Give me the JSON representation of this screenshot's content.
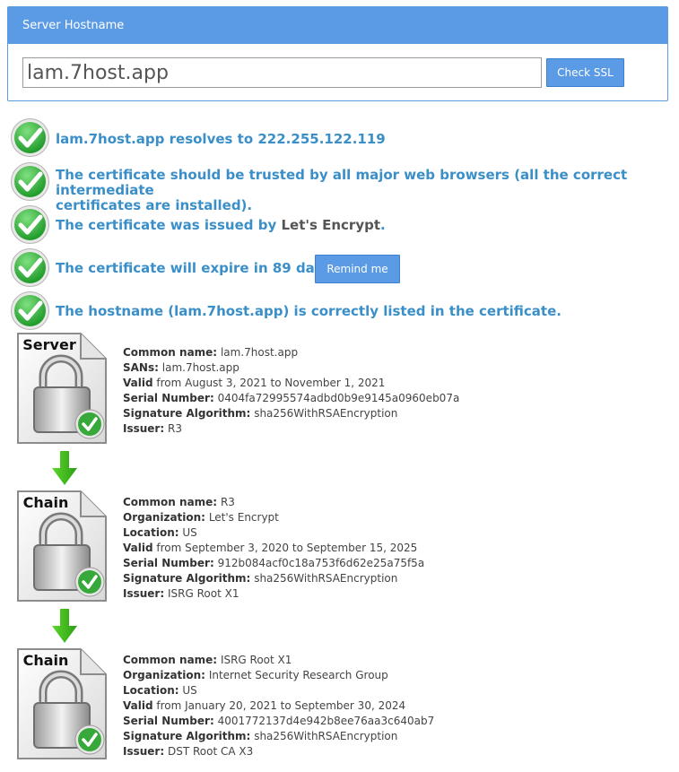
{
  "header": {
    "title": "Server Hostname"
  },
  "search": {
    "value": "lam.7host.app",
    "button": "Check SSL"
  },
  "results": {
    "r1": "lam.7host.app resolves to 222.255.122.119",
    "r2a": "The certificate should be trusted by all major web browsers (all the correct intermediate",
    "r2b": "certificates are installed).",
    "r3_prefix": "The certificate was issued by ",
    "r3_issuer": "Let's Encrypt",
    "r3_suffix": ".",
    "r4": "The certificate will expire in 89 days.",
    "remind": "Remind me",
    "r5": "The hostname (lam.7host.app) is correctly listed in the certificate."
  },
  "certs": [
    {
      "label": "Server",
      "rows": [
        {
          "k": "Common name:",
          "v": "lam.7host.app"
        },
        {
          "k": "SANs:",
          "v": "lam.7host.app"
        },
        {
          "k": "Valid",
          "v": "from August 3, 2021 to November 1, 2021"
        },
        {
          "k": "Serial Number:",
          "v": "0404fa72995574adbd0b9e9145a0960eb07a"
        },
        {
          "k": "Signature Algorithm:",
          "v": "sha256WithRSAEncryption"
        },
        {
          "k": "Issuer:",
          "v": "R3"
        }
      ]
    },
    {
      "label": "Chain",
      "rows": [
        {
          "k": "Common name:",
          "v": "R3"
        },
        {
          "k": "Organization:",
          "v": "Let's Encrypt"
        },
        {
          "k": "Location:",
          "v": "US"
        },
        {
          "k": "Valid",
          "v": "from September 3, 2020 to September 15, 2025"
        },
        {
          "k": "Serial Number:",
          "v": "912b084acf0c18a753f6d62e25a75f5a"
        },
        {
          "k": "Signature Algorithm:",
          "v": "sha256WithRSAEncryption"
        },
        {
          "k": "Issuer:",
          "v": "ISRG Root X1"
        }
      ]
    },
    {
      "label": "Chain",
      "rows": [
        {
          "k": "Common name:",
          "v": "ISRG Root X1"
        },
        {
          "k": "Organization:",
          "v": "Internet Security Research Group"
        },
        {
          "k": "Location:",
          "v": "US"
        },
        {
          "k": "Valid",
          "v": "from January 20, 2021 to September 30, 2024"
        },
        {
          "k": "Serial Number:",
          "v": "4001772137d4e942b8ee76aa3c640ab7"
        },
        {
          "k": "Signature Algorithm:",
          "v": "sha256WithRSAEncryption"
        },
        {
          "k": "Issuer:",
          "v": "DST Root CA X3"
        }
      ]
    }
  ],
  "icons": {
    "check": "green-check-icon",
    "cert": "padlock-document-icon",
    "arrow": "green-down-arrow-icon"
  },
  "colors": {
    "accent": "#5b9be6",
    "link": "#3b8fc8",
    "success": "#3cb43c"
  }
}
